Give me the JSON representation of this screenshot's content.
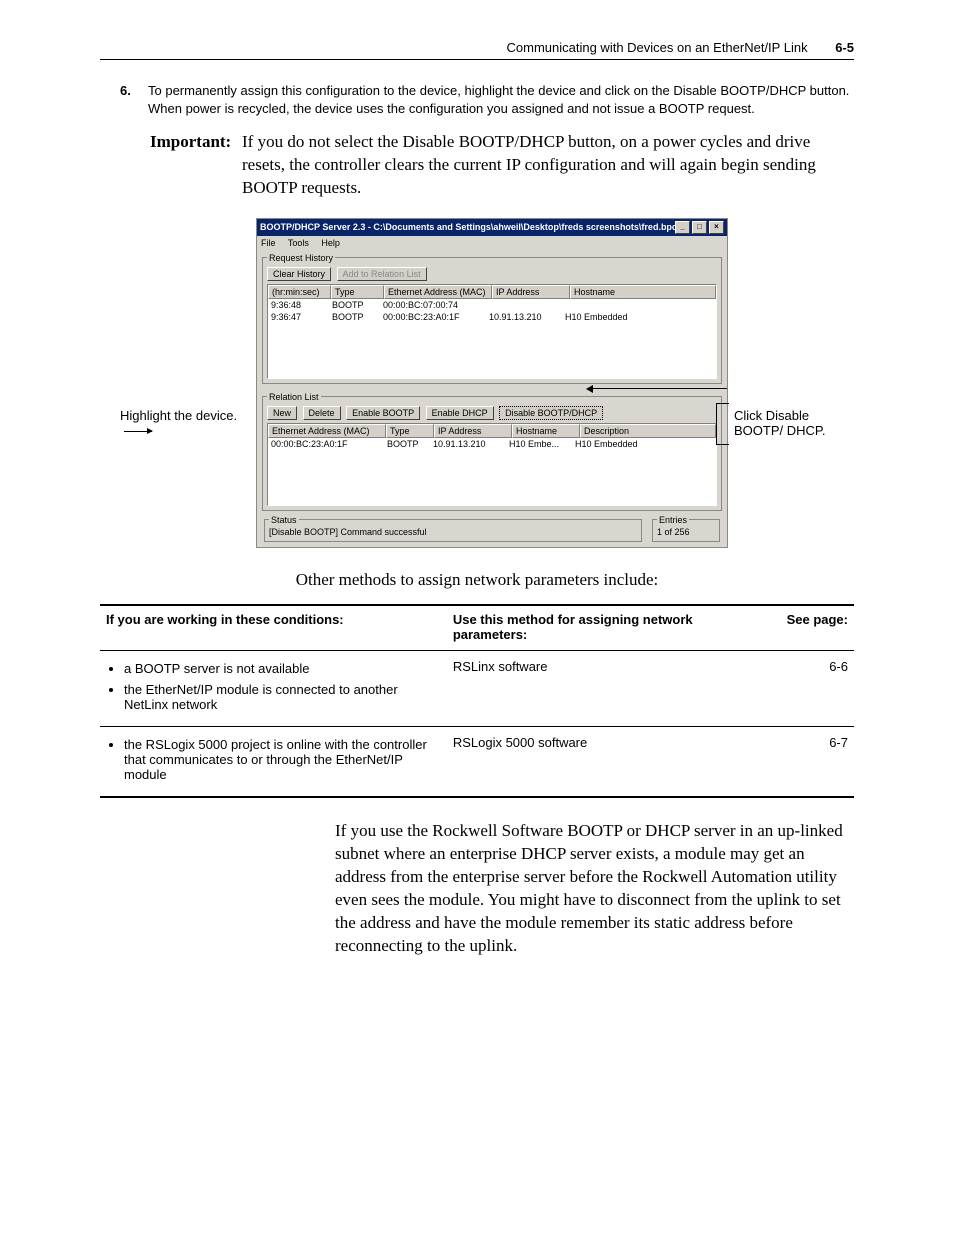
{
  "header": {
    "title": "Communicating with Devices on an EtherNet/IP Link",
    "page": "6-5"
  },
  "step": {
    "number": "6.",
    "text": "To permanently assign this configuration to the device, highlight the device and click on the Disable BOOTP/DHCP button. When power is recycled, the device uses the configuration you assigned and not issue a BOOTP request."
  },
  "important": {
    "label": "Important:",
    "text": "If you do not select the Disable BOOTP/DHCP button, on a power cycles and drive resets, the controller clears the current IP configuration and will again begin sending BOOTP requests."
  },
  "callouts": {
    "left": "Highlight the device.",
    "right": "Click Disable BOOTP/ DHCP."
  },
  "shot": {
    "title": "BOOTP/DHCP Server 2.3 - C:\\Documents and Settings\\ahweil\\Desktop\\freds screenshots\\fred.bpc",
    "menus": [
      "File",
      "Tools",
      "Help"
    ],
    "request_history": {
      "legend": "Request History",
      "clear_btn": "Clear History",
      "add_btn": "Add to Relation List",
      "columns": {
        "time": "(hr:min:sec)",
        "type": "Type",
        "mac": "Ethernet Address (MAC)",
        "ip": "IP Address",
        "host": "Hostname"
      },
      "rows": [
        {
          "time": "9:36:48",
          "type": "BOOTP",
          "mac": "00:00:BC:07:00:74",
          "ip": "",
          "host": ""
        },
        {
          "time": "9:36:47",
          "type": "BOOTP",
          "mac": "00:00:BC:23:A0:1F",
          "ip": "10.91.13.210",
          "host": "H10 Embedded"
        }
      ]
    },
    "relation_list": {
      "legend": "Relation List",
      "buttons": {
        "new": "New",
        "delete": "Delete",
        "enable_bootp": "Enable BOOTP",
        "enable_dhcp": "Enable DHCP",
        "disable": "Disable BOOTP/DHCP"
      },
      "columns": {
        "mac": "Ethernet Address (MAC)",
        "type": "Type",
        "ip": "IP Address",
        "host": "Hostname",
        "desc": "Description"
      },
      "rows": [
        {
          "mac": "00:00:BC:23:A0:1F",
          "type": "BOOTP",
          "ip": "10.91.13.210",
          "host": "H10 Embe...",
          "desc": "H10 Embedded"
        }
      ]
    },
    "status": {
      "legend": "Status",
      "text": "[Disable BOOTP] Command successful"
    },
    "entries": {
      "legend": "Entries",
      "text": "1 of 256"
    }
  },
  "caption": "Other methods to assign network parameters include:",
  "guide": {
    "headers": {
      "cond": "If you are working in these conditions:",
      "method": "Use this method for assigning network parameters:",
      "page": "See page:"
    },
    "rows": [
      {
        "cond_bullets": [
          "a BOOTP server is not available",
          "the EtherNet/IP module is connected to another NetLinx network"
        ],
        "method": "RSLinx software",
        "page": "6-6"
      },
      {
        "cond_bullets": [
          "the RSLogix 5000 project is online with the controller that communicates to or through the EtherNet/IP module"
        ],
        "method": "RSLogix 5000 software",
        "page": "6-7"
      }
    ]
  },
  "closing_para": "If you use the Rockwell Software BOOTP or DHCP server in an up-linked subnet where an enterprise DHCP server exists, a module may get an address from the enterprise server before the Rockwell Automation utility even sees the module. You might have to disconnect from the uplink to set the address and have the module remember its static address before reconnecting to the uplink."
}
